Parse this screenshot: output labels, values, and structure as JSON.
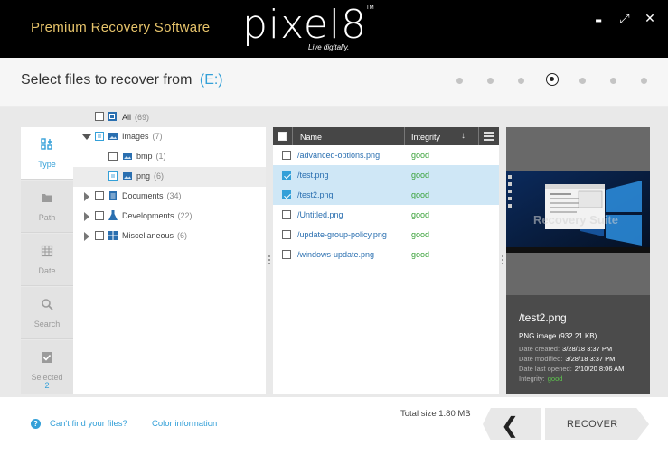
{
  "header": {
    "app_title": "Premium Recovery Software",
    "logo_text": "pixel8",
    "logo_tm": "TM",
    "logo_tagline": "Live digitally."
  },
  "window_controls": {
    "minimize": "▬",
    "restore": "⤢",
    "close": "✕"
  },
  "subheader": {
    "title": "Select files to recover from",
    "drive": "(E:)",
    "steps_total": 7,
    "current_step": 4
  },
  "sidebar": {
    "tabs": [
      {
        "label": "Type",
        "icon": "type-icon",
        "active": true
      },
      {
        "label": "Path",
        "icon": "folder-icon",
        "active": false
      },
      {
        "label": "Date",
        "icon": "calendar-icon",
        "active": false
      },
      {
        "label": "Search",
        "icon": "search-icon",
        "active": false
      },
      {
        "label": "Selected",
        "icon": "checkbox-icon",
        "active": false,
        "count": "2"
      }
    ]
  },
  "tree": {
    "all": {
      "label": "All",
      "count": "(69)"
    },
    "items": [
      {
        "label": "Images",
        "count": "(7)",
        "expanded": true,
        "level": 0,
        "check": "partial",
        "icon": "image-icon"
      },
      {
        "label": "bmp",
        "count": "(1)",
        "level": 1,
        "check": "none",
        "icon": "bmp-icon"
      },
      {
        "label": "png",
        "count": "(6)",
        "level": 1,
        "check": "partial",
        "icon": "png-icon",
        "selected": true
      },
      {
        "label": "Documents",
        "count": "(34)",
        "expanded": false,
        "level": 0,
        "check": "none",
        "icon": "document-icon"
      },
      {
        "label": "Developments",
        "count": "(22)",
        "expanded": false,
        "level": 0,
        "check": "none",
        "icon": "flask-icon"
      },
      {
        "label": "Miscellaneous",
        "count": "(6)",
        "expanded": false,
        "level": 0,
        "check": "none",
        "icon": "windows-icon"
      }
    ]
  },
  "filelist": {
    "col_name": "Name",
    "col_integrity": "Integrity",
    "sort_glyph": "↓",
    "rows": [
      {
        "name": "/advanced-options.png",
        "integrity": "good",
        "checked": false,
        "selected": false
      },
      {
        "name": "/test.png",
        "integrity": "good",
        "checked": true,
        "selected": true
      },
      {
        "name": "/test2.png",
        "integrity": "good",
        "checked": true,
        "selected": true
      },
      {
        "name": "/Untitled.png",
        "integrity": "good",
        "checked": false,
        "selected": false
      },
      {
        "name": "/update-group-policy.png",
        "integrity": "good",
        "checked": false,
        "selected": false
      },
      {
        "name": "/windows-update.png",
        "integrity": "good",
        "checked": false,
        "selected": false
      }
    ]
  },
  "preview": {
    "watermark": "Recovery Suite",
    "file_name": "/test2.png",
    "file_type": "PNG image",
    "file_size": "(932.21 KB)",
    "date_created_label": "Date created:",
    "date_created": "3/28/18 3:37 PM",
    "date_modified_label": "Date modified:",
    "date_modified": "3/28/18 3:37 PM",
    "date_opened_label": "Date last opened:",
    "date_opened": "2/10/20 8:06 AM",
    "integrity_label": "Integrity:",
    "integrity": "good"
  },
  "footer": {
    "help_icon": "?",
    "help_link": "Can't find your files?",
    "color_link": "Color information",
    "total_size": "Total size 1.80 MB",
    "back_glyph": "❮",
    "recover_label": "RECOVER"
  },
  "colors": {
    "accent": "#34a0d8",
    "header_bg": "#000000",
    "title_gold": "#e7c46b",
    "good_green": "#3aa23a",
    "selected_row": "#cfe7f6"
  }
}
